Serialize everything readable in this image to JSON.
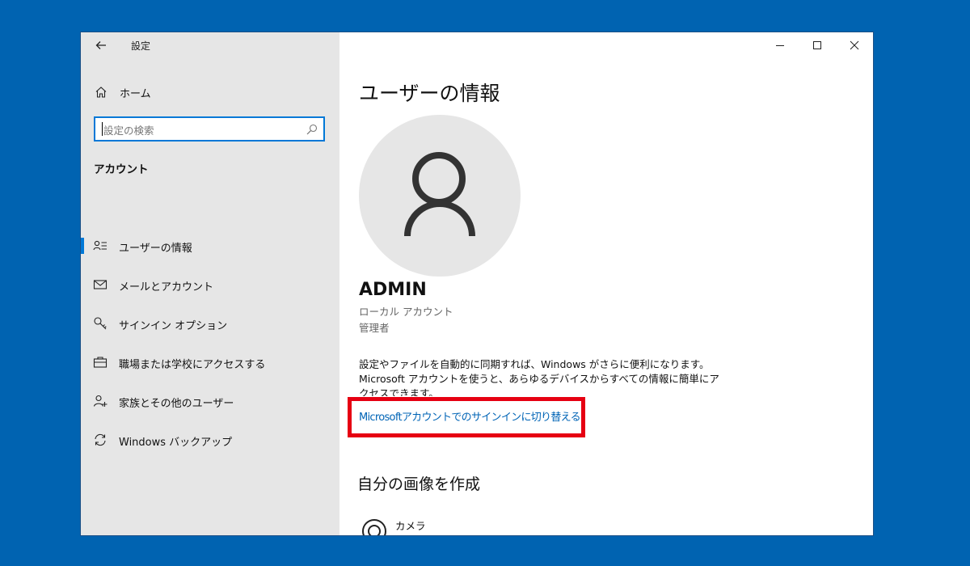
{
  "window": {
    "title": "設定",
    "controls": {
      "minimize": "minimize-icon",
      "maximize": "maximize-icon",
      "close": "close-icon"
    }
  },
  "sidebar": {
    "home_label": "ホーム",
    "search_placeholder": "設定の検索",
    "section_title": "アカウント",
    "items": [
      {
        "label": "ユーザーの情報",
        "icon": "user-info-icon",
        "selected": true
      },
      {
        "label": "メールとアカウント",
        "icon": "mail-icon",
        "selected": false
      },
      {
        "label": "サインイン オプション",
        "icon": "key-icon",
        "selected": false
      },
      {
        "label": "職場または学校にアクセスする",
        "icon": "briefcase-icon",
        "selected": false
      },
      {
        "label": "家族とその他のユーザー",
        "icon": "add-person-icon",
        "selected": false
      },
      {
        "label": "Windows バックアップ",
        "icon": "sync-icon",
        "selected": false
      }
    ]
  },
  "main": {
    "title": "ユーザーの情報",
    "account_name": "ADMIN",
    "account_type": "ローカル アカウント",
    "account_role": "管理者",
    "description": "設定やファイルを自動的に同期すれば、Windows がさらに便利になります。Microsoft アカウントを使うと、あらゆるデバイスからすべての情報に簡単にアクセスできます。",
    "switch_link": "Microsoftアカウントでのサインインに切り替える",
    "create_picture_title": "自分の画像を作成",
    "camera_label": "カメラ"
  },
  "colors": {
    "desktop": "#0063b1",
    "sidebar_bg": "#e6e6e6",
    "accent": "#0078d7",
    "link": "#0064b6",
    "highlight_box": "#e60012"
  }
}
